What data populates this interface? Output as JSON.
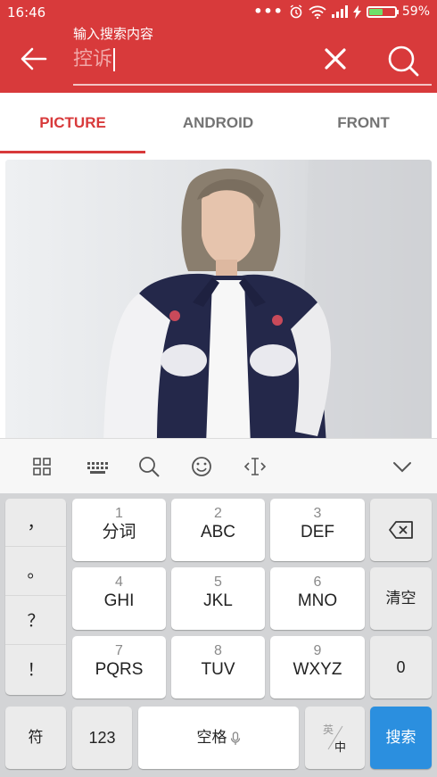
{
  "status_bar": {
    "time": "16:46",
    "more": "•••",
    "battery_text": "59%",
    "battery_level": 0.59
  },
  "toolbar": {
    "hint_label": "输入搜索内容",
    "search_value": "控诉"
  },
  "tabs": [
    {
      "label": "PICTURE",
      "active": true
    },
    {
      "label": "ANDROID",
      "active": false
    },
    {
      "label": "FRONT",
      "active": false
    }
  ],
  "keyboard": {
    "toolbar_icons": [
      "grid-icon",
      "keyboard-icon",
      "search-icon",
      "emoji-icon",
      "cursor-icon",
      "collapse-icon"
    ],
    "punctuation": [
      "，",
      "。",
      "？",
      "！"
    ],
    "keys": [
      {
        "num": "1",
        "label": "分词"
      },
      {
        "num": "2",
        "label": "ABC"
      },
      {
        "num": "3",
        "label": "DEF"
      },
      {
        "num": "4",
        "label": "GHI"
      },
      {
        "num": "5",
        "label": "JKL"
      },
      {
        "num": "6",
        "label": "MNO"
      },
      {
        "num": "7",
        "label": "PQRS"
      },
      {
        "num": "8",
        "label": "TUV"
      },
      {
        "num": "9",
        "label": "WXYZ"
      }
    ],
    "clear_label": "清空",
    "zero_label": "0",
    "symbol_label": "符",
    "numbers_label": "123",
    "space_label": "空格",
    "lang_top": "英",
    "lang_bottom": "中",
    "search_label": "搜索"
  },
  "colors": {
    "accent": "#d83a3b",
    "enter_key": "#2b8fdf"
  }
}
